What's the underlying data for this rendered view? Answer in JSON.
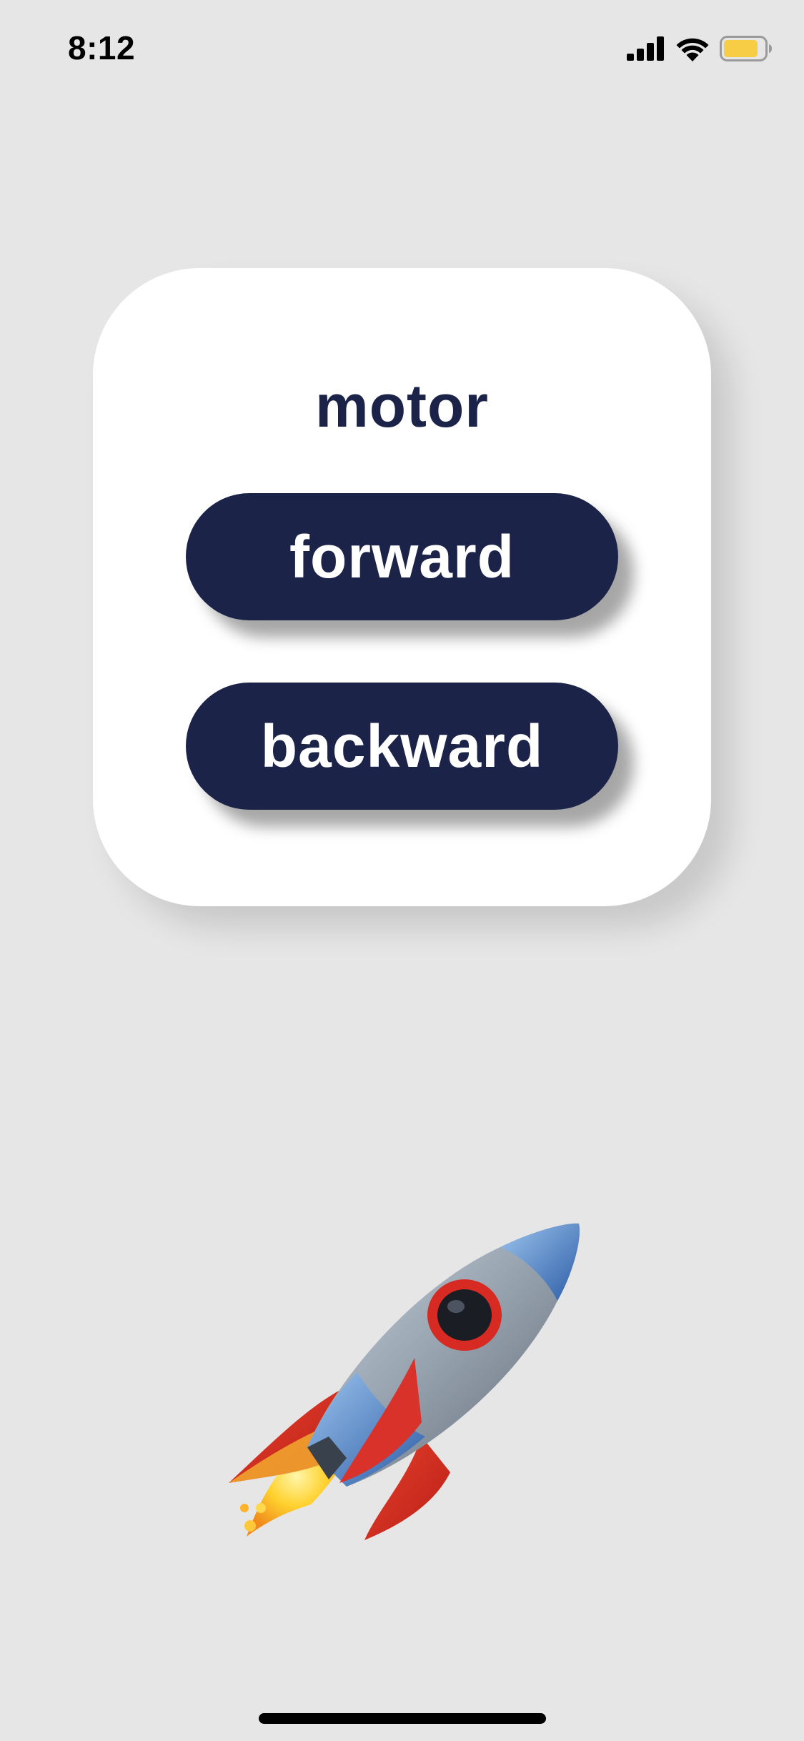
{
  "status_bar": {
    "time": "8:12",
    "battery_color": "#f7cd46"
  },
  "motor_card": {
    "title": "motor",
    "forward_label": "forward",
    "backward_label": "backward"
  },
  "illustration": {
    "icon": "rocket-icon"
  },
  "colors": {
    "background": "#e6e6e6",
    "card": "#ffffff",
    "accent": "#1b2349",
    "button_text": "#ffffff"
  }
}
